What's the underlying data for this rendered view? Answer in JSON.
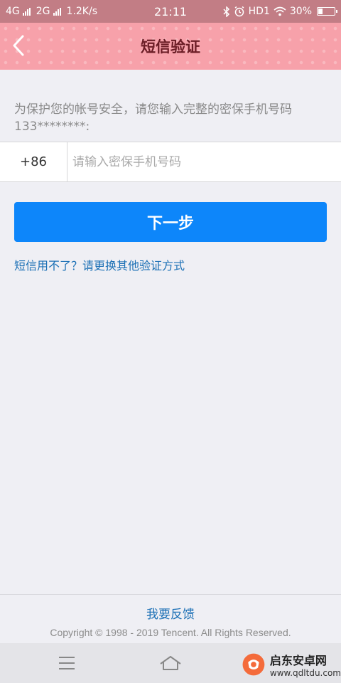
{
  "status_bar": {
    "network1": "4G",
    "network2": "2G",
    "speed": "1.2K/s",
    "time": "21:11",
    "hd": "HD1",
    "battery_text": "30%",
    "battery_level": 0.3
  },
  "header": {
    "title": "短信验证",
    "back_icon": "chevron-left-icon",
    "bg_color": "#f7a1aa"
  },
  "main": {
    "description": "为保护您的帐号安全，请您输入完整的密保手机号码133********:",
    "country_code": "+86",
    "phone_input": {
      "value": "",
      "placeholder": "请输入密保手机号码"
    },
    "next_button": "下一步",
    "alt_link": "短信用不了？请更换其他验证方式",
    "accent_color": "#0d86fa"
  },
  "footer": {
    "feedback": "我要反馈",
    "copyright": "Copyright © 1998 - 2019 Tencent. All Rights Reserved."
  },
  "navbar": {
    "menu_icon": "menu-icon",
    "home_icon": "home-icon"
  },
  "watermark": {
    "title": "启东安卓网",
    "url": "www.qdltdu.com"
  }
}
